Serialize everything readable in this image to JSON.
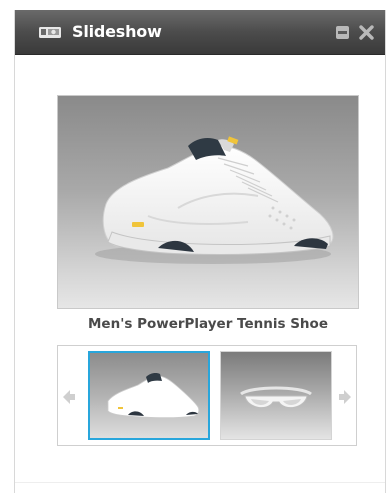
{
  "widget": {
    "title": "Slideshow",
    "icons": {
      "title": "camera-icon",
      "minimize": "minimize-icon",
      "close": "close-icon"
    }
  },
  "slideshow": {
    "current_caption": "Men's PowerPlayer Tennis Shoe",
    "main_image": "tennis-shoe-image",
    "thumbnails": [
      {
        "image": "tennis-shoe-thumbnail",
        "selected": true
      },
      {
        "image": "sunglasses-thumbnail",
        "selected": false
      }
    ],
    "prev_icon": "arrow-left-icon",
    "next_icon": "arrow-right-icon"
  },
  "colors": {
    "selected_border": "#28a6dc",
    "titlebar": "#4c4c4c",
    "caption": "#4a4a4a"
  }
}
